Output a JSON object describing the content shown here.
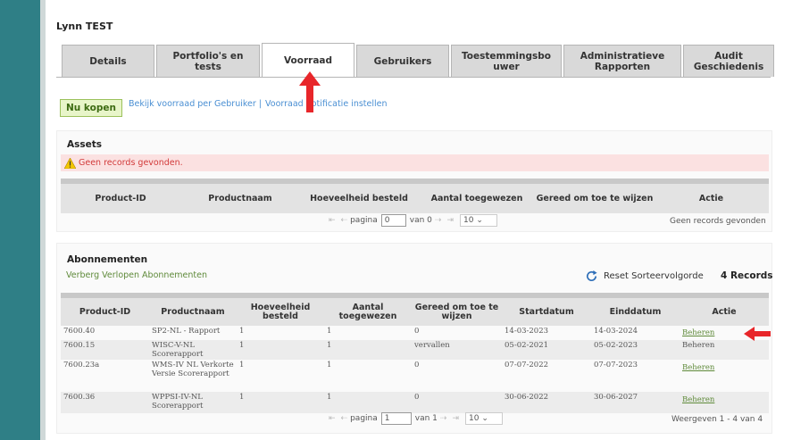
{
  "user": {
    "name": "Lynn TEST"
  },
  "tabs": [
    {
      "label": "Details",
      "active": false
    },
    {
      "label": "Portfolio's en tests",
      "active": false
    },
    {
      "label": "Voorraad",
      "active": true
    },
    {
      "label": "Gebruikers",
      "active": false
    },
    {
      "label": "Toestemmingsbo uwer",
      "active": false
    },
    {
      "label": "Administratieve Rapporten",
      "active": false
    },
    {
      "label": "Audit Geschiedenis",
      "active": false
    }
  ],
  "actions": {
    "buy_label": "Nu kopen",
    "link_by_user": "Bekijk voorraad per Gebruiker |",
    "link_notification": "Voorraad notificatie instellen"
  },
  "assets": {
    "title": "Assets",
    "error": "Geen records gevonden.",
    "columns": [
      "Product-ID",
      "Productnaam",
      "Hoeveelheid besteld",
      "Aantal toegewezen",
      "Gereed om toe te wijzen",
      "Actie"
    ],
    "pager": {
      "page_label": "pagina",
      "page_value": "0",
      "of_label": "van 0",
      "size": "10"
    },
    "status": "Geen records gevonden"
  },
  "subscriptions": {
    "title": "Abonnementen",
    "hide_link": "Verberg Verlopen Abonnementen",
    "reset_label": "Reset Sorteervolgorde",
    "records_label": "4 Records",
    "columns": [
      "Product-ID",
      "Productnaam",
      "Hoeveelheid besteld",
      "Aantal toegewezen",
      "Gereed om toe te wijzen",
      "Startdatum",
      "Einddatum",
      "Actie"
    ],
    "rows": [
      {
        "id": "7600.40",
        "name": "SP2-NL - Rapport",
        "ordered": "1",
        "assigned": "1",
        "ready": "0",
        "start": "14-03-2023",
        "end": "14-03-2024",
        "action": "Beheren",
        "action_link": true
      },
      {
        "id": "7600.15",
        "name": "WISC-V-NL Scorerapport",
        "ordered": "1",
        "assigned": "1",
        "ready": "vervallen",
        "start": "05-02-2021",
        "end": "05-02-2023",
        "action": "Beheren",
        "action_link": false
      },
      {
        "id": "7600.23a",
        "name": "WMS-IV NL Verkorte Versie Scorerapport",
        "ordered": "1",
        "assigned": "1",
        "ready": "0",
        "start": "07-07-2022",
        "end": "07-07-2023",
        "action": "Beheren",
        "action_link": true
      },
      {
        "id": "7600.36",
        "name": "WPPSI-IV-NL Scorerapport",
        "ordered": "1",
        "assigned": "1",
        "ready": "0",
        "start": "30-06-2022",
        "end": "30-06-2027",
        "action": "Beheren",
        "action_link": true
      }
    ],
    "pager": {
      "page_label": "pagina",
      "page_value": "1",
      "of_label": "van 1",
      "size": "10"
    },
    "status": "Weergeven 1 - 4 van 4"
  },
  "colors": {
    "accent_green": "#5f8a3a",
    "link_blue": "#4a8fd3",
    "error_red": "#d23a3a",
    "arrow_red": "#e8262a",
    "frame_teal": "#2f7f86"
  },
  "icons": [
    "warning-icon",
    "refresh-icon",
    "red-arrow-up-icon",
    "red-arrow-left-icon"
  ]
}
